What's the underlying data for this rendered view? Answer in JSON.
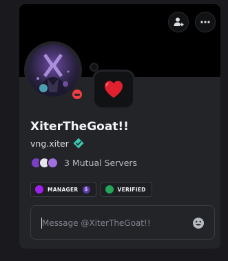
{
  "profile": {
    "display_name": "XiterTheGoat!!",
    "username": "vng.xiter",
    "mutual_servers": "3 Mutual Servers",
    "status": "do-not-disturb",
    "custom_status_emoji": "red-heart"
  },
  "header": {
    "add_friend_icon": "add-friend-icon",
    "more_icon": "more-options-icon"
  },
  "roles": [
    {
      "label": "MANAGER",
      "color": "#a020f0",
      "emoji": "$"
    },
    {
      "label": "VERIFIED",
      "color": "#23a55a"
    }
  ],
  "message": {
    "placeholder": "Message @XiterTheGoat!!"
  },
  "colors": {
    "card_bg": "#232428",
    "banner": "#000000",
    "dnd_red": "#f23f43",
    "verified_teal": "#3ec6b0",
    "heart_red": "#e0202e"
  }
}
